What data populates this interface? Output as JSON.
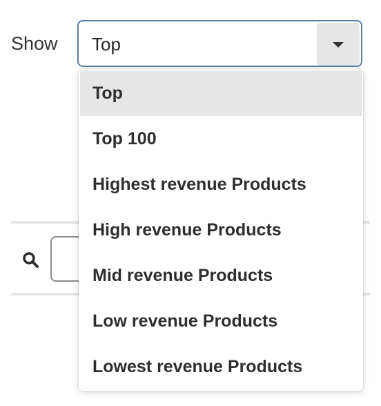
{
  "filter": {
    "show_label": "Show",
    "selected_value": "Top",
    "options": [
      "Top",
      "Top 100",
      "Highest revenue Products",
      "High revenue Products",
      "Mid revenue Products",
      "Low revenue Products",
      "Lowest revenue Products"
    ]
  },
  "icons": {
    "toggle": "caret-down-icon",
    "search": "search-icon"
  },
  "colors": {
    "select_border": "#5b7ea6",
    "selected_option_bg": "#e6e6e6"
  }
}
